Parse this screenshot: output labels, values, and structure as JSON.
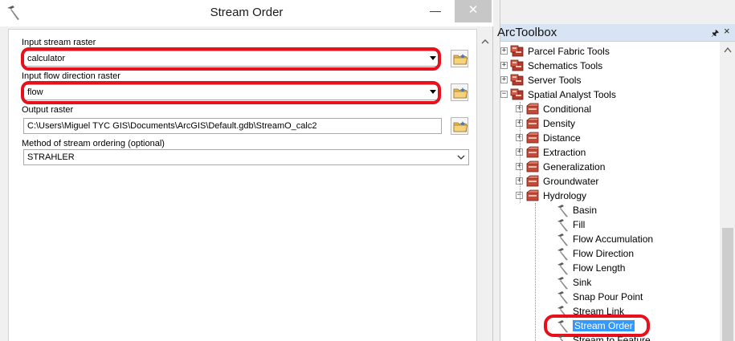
{
  "dialog": {
    "title": "Stream Order",
    "window_controls": {
      "minimize": "—",
      "close": "✕"
    },
    "fields": {
      "input_stream_raster": {
        "label": "Input stream raster",
        "value": "calculator"
      },
      "input_flow_direction_raster": {
        "label": "Input flow direction raster",
        "value": "flow"
      },
      "output_raster": {
        "label": "Output raster",
        "value": "C:\\Users\\Miguel TYC GIS\\Documents\\ArcGIS\\Default.gdb\\StreamO_calc2"
      },
      "method": {
        "label": "Method of stream ordering (optional)",
        "value": "STRAHLER"
      }
    }
  },
  "toolbox": {
    "title": "ArcToolbox",
    "pin": "🖈",
    "close": "×",
    "items": [
      {
        "label": "Parcel Fabric Tools",
        "level": 0,
        "type": "toolbox",
        "expander": "+"
      },
      {
        "label": "Schematics Tools",
        "level": 0,
        "type": "toolbox",
        "expander": "+"
      },
      {
        "label": "Server Tools",
        "level": 0,
        "type": "toolbox",
        "expander": "+"
      },
      {
        "label": "Spatial Analyst Tools",
        "level": 0,
        "type": "toolbox",
        "expander": "−"
      },
      {
        "label": "Conditional",
        "level": 1,
        "type": "toolset",
        "expander": "+"
      },
      {
        "label": "Density",
        "level": 1,
        "type": "toolset",
        "expander": "+"
      },
      {
        "label": "Distance",
        "level": 1,
        "type": "toolset",
        "expander": "+"
      },
      {
        "label": "Extraction",
        "level": 1,
        "type": "toolset",
        "expander": "+"
      },
      {
        "label": "Generalization",
        "level": 1,
        "type": "toolset",
        "expander": "+"
      },
      {
        "label": "Groundwater",
        "level": 1,
        "type": "toolset",
        "expander": "+"
      },
      {
        "label": "Hydrology",
        "level": 1,
        "type": "toolset",
        "expander": "−"
      },
      {
        "label": "Basin",
        "level": 2,
        "type": "tool"
      },
      {
        "label": "Fill",
        "level": 2,
        "type": "tool"
      },
      {
        "label": "Flow Accumulation",
        "level": 2,
        "type": "tool"
      },
      {
        "label": "Flow Direction",
        "level": 2,
        "type": "tool"
      },
      {
        "label": "Flow Length",
        "level": 2,
        "type": "tool"
      },
      {
        "label": "Sink",
        "level": 2,
        "type": "tool"
      },
      {
        "label": "Snap Pour Point",
        "level": 2,
        "type": "tool"
      },
      {
        "label": "Stream Link",
        "level": 2,
        "type": "tool"
      },
      {
        "label": "Stream Order",
        "level": 2,
        "type": "tool",
        "selected": true
      },
      {
        "label": "Stream to Feature",
        "level": 2,
        "type": "tool"
      }
    ]
  },
  "colors": {
    "highlight_outline": "#e8111b",
    "selection": "#3399ff",
    "header": "#d8e4f4"
  }
}
